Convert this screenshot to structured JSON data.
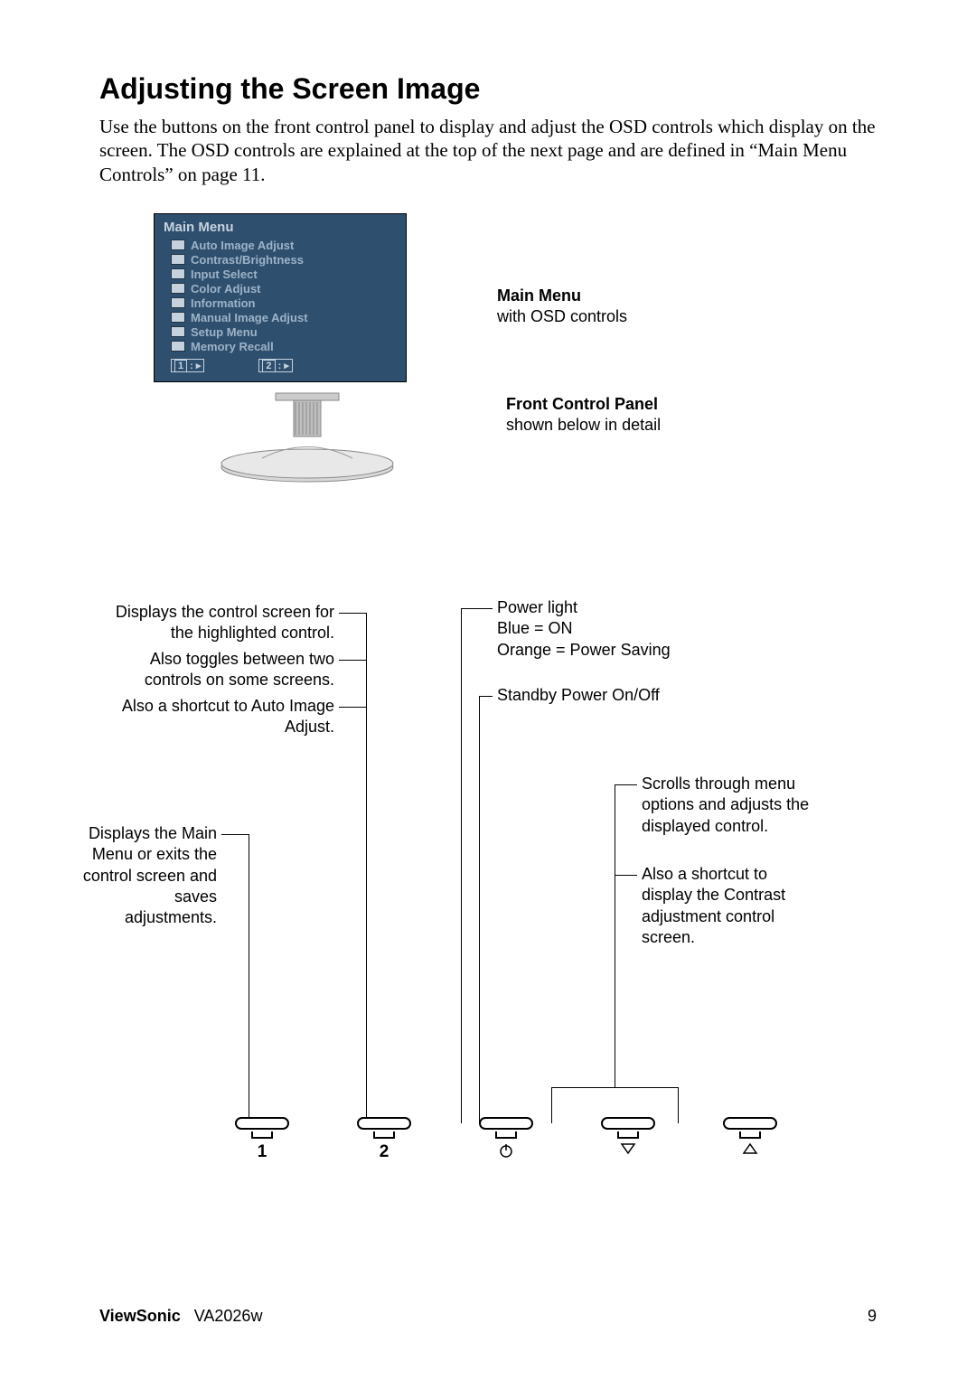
{
  "title": "Adjusting the Screen Image",
  "intro": "Use the buttons on the front control panel to display and adjust the OSD controls which display on the screen. The OSD controls are explained at the top of the next page and are defined in “Main Menu Controls” on page 11.",
  "osd": {
    "title": "Main Menu",
    "items": [
      "Auto Image Adjust",
      "Contrast/Brightness",
      "Input Select",
      "Color Adjust",
      "Information",
      "Manual Image Adjust",
      "Setup Menu",
      "Memory Recall"
    ],
    "hint1": "1",
    "hint2": "2"
  },
  "callouts": {
    "mainmenu_title": "Main Menu",
    "mainmenu_sub": "with OSD controls",
    "panel_title": "Front Control Panel",
    "panel_sub": "shown below in detail"
  },
  "descriptions": {
    "btn2_a": "Displays the control screen for the highlighted control.",
    "btn2_b": "Also toggles between two controls on some screens.",
    "btn2_c": "Also a shortcut to Auto Image Adjust.",
    "btn1": "Displays the Main Menu or exits the control screen and saves adjustments.",
    "power_a": "Power light",
    "power_b": "Blue = ON",
    "power_c": "Orange = Power Saving",
    "standby": "Standby Power On/Off",
    "arrows_a": "Scrolls through menu options and adjusts the displayed control.",
    "arrows_b": "Also a shortcut to display the Contrast adjustment control screen."
  },
  "buttons": {
    "b1": "1",
    "b2": "2"
  },
  "footer": {
    "brand": "ViewSonic",
    "model": "VA2026w",
    "page": "9"
  }
}
